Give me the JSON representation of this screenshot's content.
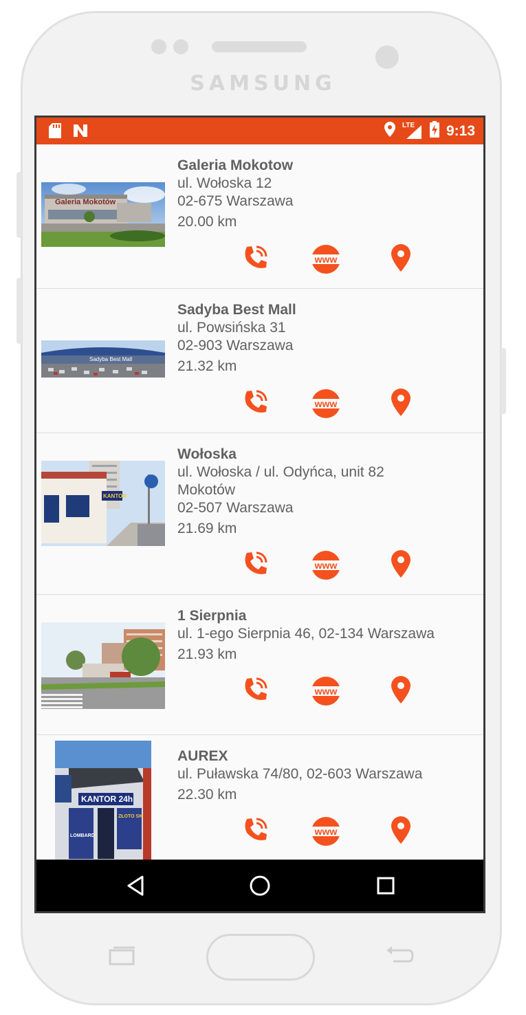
{
  "device": {
    "brand": "SAMSUNG"
  },
  "status_bar": {
    "time": "9:13",
    "network": "LTE",
    "icons": [
      "sd-card-icon",
      "n-notification-icon",
      "location-icon",
      "signal-icon",
      "battery-charging-icon"
    ]
  },
  "theme": {
    "accent": "#e64a19",
    "icon_color": "#f4511e",
    "text": "#616161"
  },
  "locations": [
    {
      "name": "Galeria Mokotow",
      "address_lines": [
        "ul. Wołoska 12",
        "02-675 Warszawa"
      ],
      "distance": "20.00 km"
    },
    {
      "name": "Sadyba Best Mall",
      "address_lines": [
        "ul. Powsińska 31",
        "02-903 Warszawa"
      ],
      "distance": "21.32 km"
    },
    {
      "name": "Wołoska",
      "address_lines": [
        "ul. Wołoska / ul. Odyńca, unit 82",
        "Mokotów",
        "02-507 Warszawa"
      ],
      "distance": "21.69 km"
    },
    {
      "name": "1 Sierpnia",
      "address_lines": [
        "ul. 1-ego Sierpnia 46, 02-134 Warszawa"
      ],
      "distance": "21.93 km"
    },
    {
      "name": "AUREX",
      "address_lines": [
        "ul. Puławska 74/80, 02-603 Warszawa"
      ],
      "distance": "22.30 km"
    }
  ],
  "images": {
    "row1_sign": "Galeria Mokotów",
    "row2_sign": "Sadyba Best Mall",
    "row3_sign": "KANTOR",
    "row5_sign": "KANTOR 24h",
    "row5_sub": "ZŁOTO SKUP",
    "row5_sub2": "LOMBARD"
  },
  "action_labels": {
    "web": "www"
  },
  "nav": {
    "back": "back-icon",
    "home": "home-icon",
    "recents": "recents-icon"
  }
}
